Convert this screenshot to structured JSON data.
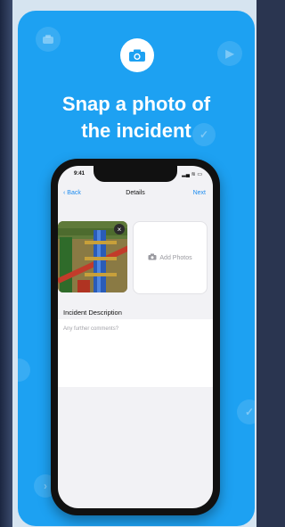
{
  "headline": {
    "line1": "Snap a photo of",
    "line2": "the incident"
  },
  "colors": {
    "card_bg": "#1da1f2",
    "link": "#1d8cf0"
  },
  "icons": {
    "badge": "camera-icon",
    "background": [
      "camera-icon",
      "send-icon",
      "check-icon",
      "chevron-icon"
    ]
  },
  "phone": {
    "status_bar": {
      "time": "9:41",
      "icons": "▂▄ ≋ ▭"
    },
    "navbar": {
      "back_label": "Back",
      "title": "Details",
      "next_label": "Next"
    },
    "photos": {
      "add_label": "Add Photos",
      "remove_label": "×"
    },
    "description": {
      "label": "Incident Description",
      "placeholder": "Any further comments?"
    }
  }
}
